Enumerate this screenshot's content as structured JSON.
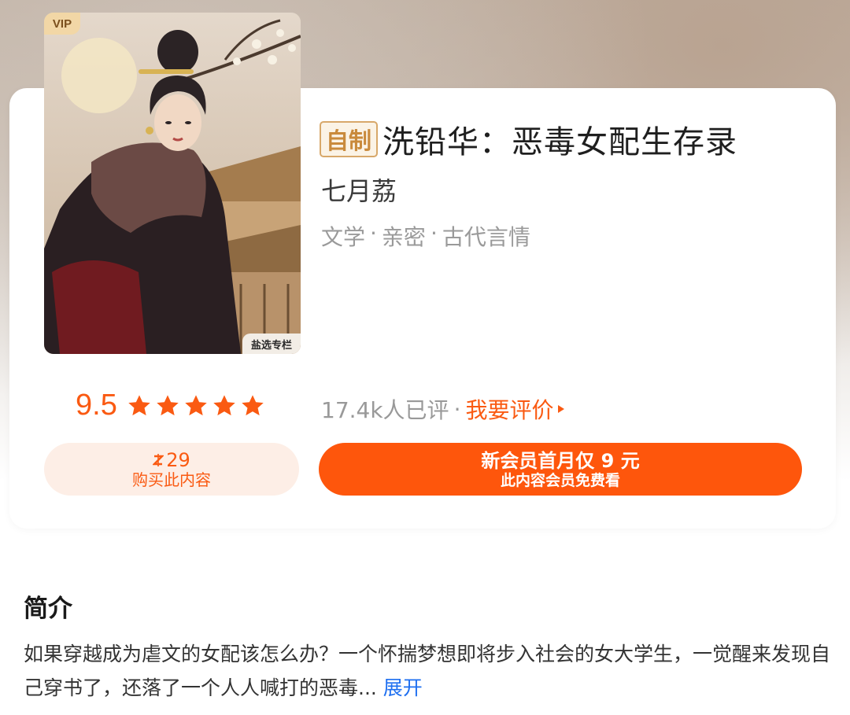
{
  "cover": {
    "vip_badge": "VIP",
    "column_badge": "盐选专栏"
  },
  "book": {
    "self_tag": "自制",
    "title": "洗铅华：恶毒女配生存录",
    "author": "七月荔",
    "tags": [
      "文学",
      "亲密",
      "古代言情"
    ],
    "tag_separator": "·"
  },
  "rating": {
    "score": "9.5",
    "stars": 5,
    "review_count": "17.4k人已评",
    "separator": "·",
    "review_link": "我要评价"
  },
  "purchase": {
    "price": "29",
    "label": "购买此内容"
  },
  "membership": {
    "main": "新会员首月仅 9 元",
    "sub": "此内容会员免费看"
  },
  "intro": {
    "heading": "简介",
    "text": "如果穿越成为虐文的女配该怎么办？一个怀揣梦想即将步入社会的女大学生，一觉醒来发现自己穿书了，还落了一个人人喊打的恶毒...",
    "expand": "展开"
  },
  "colors": {
    "accent": "#fa5a12",
    "button": "#fe560c",
    "link": "#1e6ff0",
    "self_tag": "#c98a3c"
  }
}
